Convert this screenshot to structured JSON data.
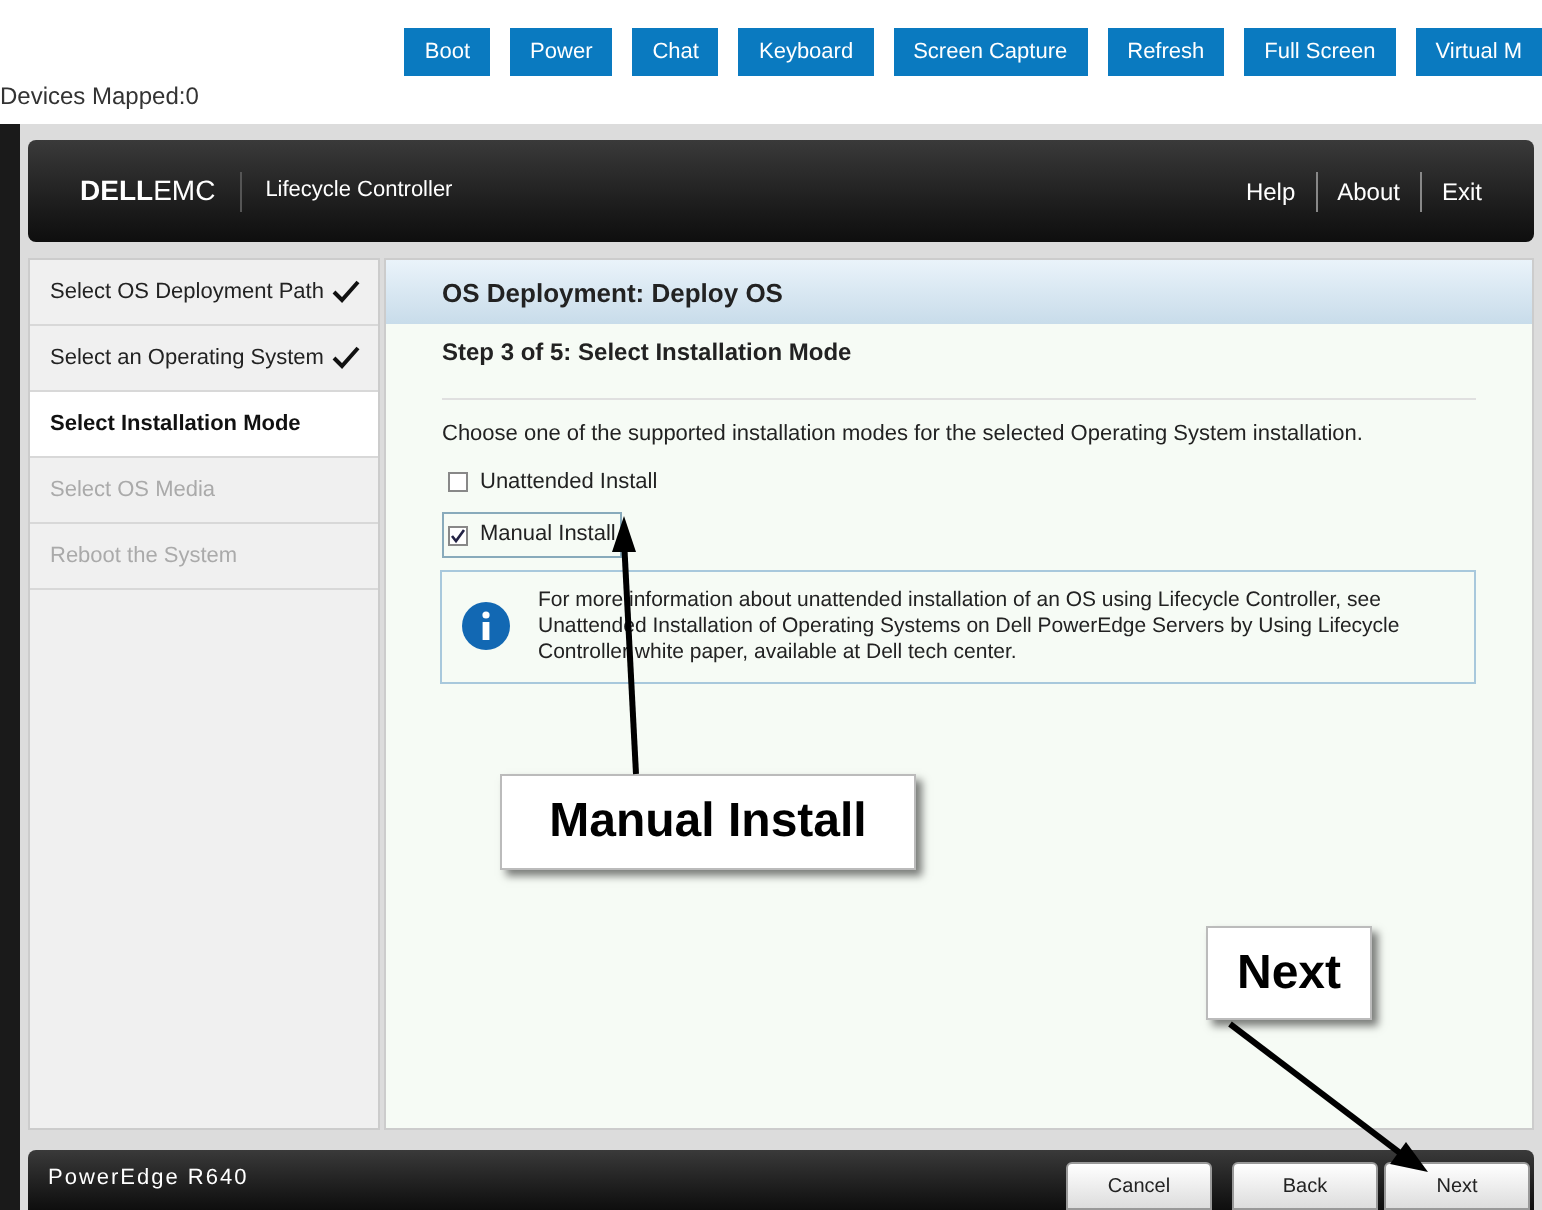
{
  "toolbar": {
    "buttons": [
      "Boot",
      "Power",
      "Chat",
      "Keyboard",
      "Screen Capture",
      "Refresh",
      "Full Screen",
      "Virtual M"
    ]
  },
  "devices_mapped": "Devices Mapped:0",
  "header": {
    "logo": {
      "brand": "DELL",
      "suffix": "EMC"
    },
    "product": "Lifecycle Controller",
    "links": [
      "Help",
      "About",
      "Exit"
    ]
  },
  "steps": [
    {
      "label": "Select OS Deployment Path",
      "done": true,
      "selected": false,
      "disabled": false
    },
    {
      "label": "Select an Operating System",
      "done": true,
      "selected": false,
      "disabled": false
    },
    {
      "label": "Select Installation Mode",
      "done": false,
      "selected": true,
      "disabled": false
    },
    {
      "label": "Select OS Media",
      "done": false,
      "selected": false,
      "disabled": true
    },
    {
      "label": "Reboot the System",
      "done": false,
      "selected": false,
      "disabled": true
    }
  ],
  "content": {
    "title": "OS Deployment: Deploy OS",
    "step_title": "Step 3 of 5: Select Installation Mode",
    "instruction": "Choose one of the supported installation modes for the selected Operating System installation.",
    "options": [
      {
        "label": "Unattended Install",
        "checked": false,
        "focused": false
      },
      {
        "label": "Manual Install",
        "checked": true,
        "focused": true
      }
    ],
    "info": "For more information about unattended installation of an OS using Lifecycle Controller, see Unattended Installation of Operating Systems on Dell PowerEdge Servers by Using Lifecycle Controller white paper, available at Dell tech center."
  },
  "footer": {
    "model": "PowerEdge R640",
    "buttons": [
      "Cancel",
      "Back",
      "Next"
    ]
  },
  "callouts": [
    {
      "text": "Manual Install"
    },
    {
      "text": "Next"
    }
  ]
}
